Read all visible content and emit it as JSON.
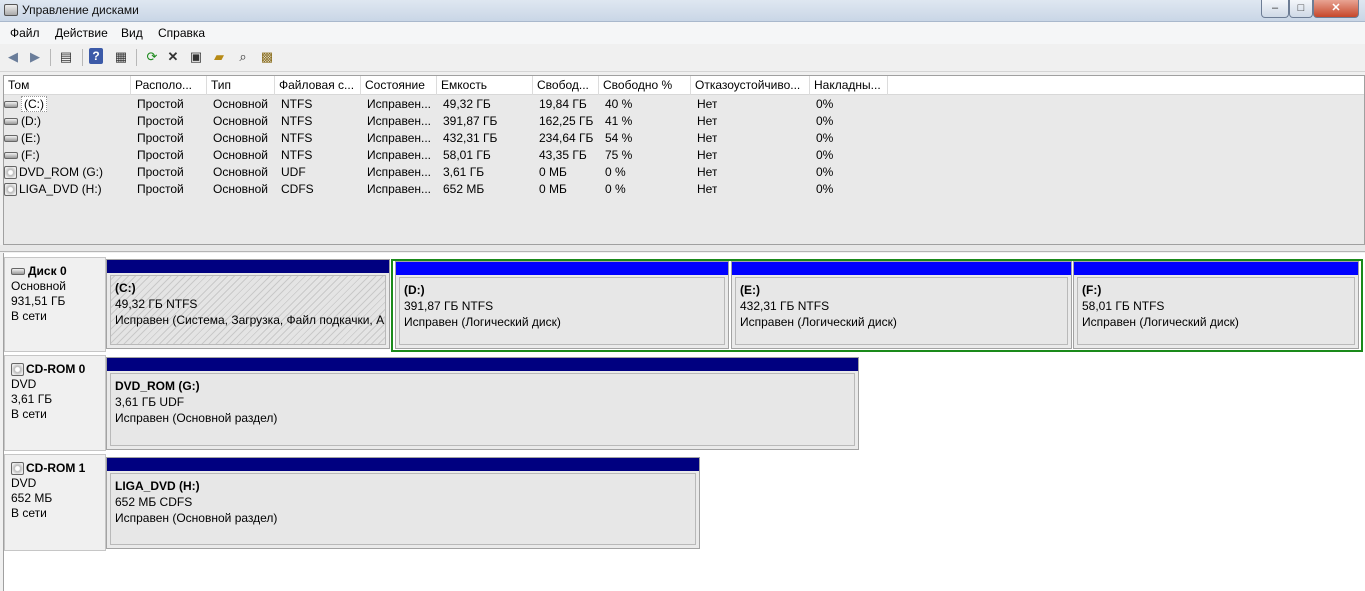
{
  "window": {
    "title": "Управление дисками",
    "min_label": "–",
    "max_label": "□",
    "close_label": "✕"
  },
  "menu": [
    "Файл",
    "Действие",
    "Вид",
    "Справка"
  ],
  "toolbar_icons": [
    "back-arrow-icon",
    "forward-arrow-icon",
    "console-tree-icon",
    "help-icon",
    "properties-icon",
    "refresh-icon",
    "delete-icon",
    "properties-icon",
    "open-icon",
    "rescan-icon",
    "wizard-icon"
  ],
  "volumes": {
    "columns": [
      "Том",
      "Располо...",
      "Тип",
      "Файловая с...",
      "Состояние",
      "Емкость",
      "Свобод...",
      "Свободно %",
      "Отказоустойчиво...",
      "Накладны..."
    ],
    "rows": [
      {
        "name": "(C:)",
        "icon": "drive",
        "layout": "Простой",
        "type": "Основной",
        "fs": "NTFS",
        "status": "Исправен...",
        "capacity": "49,32 ГБ",
        "free": "19,84 ГБ",
        "free_pct": "40 %",
        "fault": "Нет",
        "overhead": "0%"
      },
      {
        "name": "(D:)",
        "icon": "drive",
        "layout": "Простой",
        "type": "Основной",
        "fs": "NTFS",
        "status": "Исправен...",
        "capacity": "391,87 ГБ",
        "free": "162,25 ГБ",
        "free_pct": "41 %",
        "fault": "Нет",
        "overhead": "0%"
      },
      {
        "name": "(E:)",
        "icon": "drive",
        "layout": "Простой",
        "type": "Основной",
        "fs": "NTFS",
        "status": "Исправен...",
        "capacity": "432,31 ГБ",
        "free": "234,64 ГБ",
        "free_pct": "54 %",
        "fault": "Нет",
        "overhead": "0%"
      },
      {
        "name": "(F:)",
        "icon": "drive",
        "layout": "Простой",
        "type": "Основной",
        "fs": "NTFS",
        "status": "Исправен...",
        "capacity": "58,01 ГБ",
        "free": "43,35 ГБ",
        "free_pct": "75 %",
        "fault": "Нет",
        "overhead": "0%"
      },
      {
        "name": "DVD_ROM (G:)",
        "icon": "cd",
        "layout": "Простой",
        "type": "Основной",
        "fs": "UDF",
        "status": "Исправен...",
        "capacity": "3,61 ГБ",
        "free": "0 МБ",
        "free_pct": "0 %",
        "fault": "Нет",
        "overhead": "0%"
      },
      {
        "name": "LIGA_DVD (H:)",
        "icon": "cd",
        "layout": "Простой",
        "type": "Основной",
        "fs": "CDFS",
        "status": "Исправен...",
        "capacity": "652 МБ",
        "free": "0 МБ",
        "free_pct": "0 %",
        "fault": "Нет",
        "overhead": "0%"
      }
    ]
  },
  "disks": [
    {
      "name": "Диск 0",
      "type": "Основной",
      "size": "931,51 ГБ",
      "status": "В сети",
      "partitions": [
        {
          "name": "(C:)",
          "info": "49,32 ГБ NTFS",
          "status": "Исправен (Система, Загрузка, Файл подкачки, Ак",
          "bar_color": "#000080",
          "hatched": true
        },
        {
          "name": "(D:)",
          "info": "391,87 ГБ NTFS",
          "status": "Исправен (Логический диск)",
          "bar_color": "#0000ff",
          "hatched": false
        },
        {
          "name": "(E:)",
          "info": "432,31 ГБ NTFS",
          "status": "Исправен (Логический диск)",
          "bar_color": "#0000ff",
          "hatched": false
        },
        {
          "name": "(F:)",
          "info": "58,01 ГБ NTFS",
          "status": "Исправен (Логический диск)",
          "bar_color": "#0000ff",
          "hatched": false
        }
      ]
    },
    {
      "name": "CD-ROM 0",
      "type": "DVD",
      "size": "3,61 ГБ",
      "status": "В сети",
      "partitions": [
        {
          "name": "DVD_ROM  (G:)",
          "info": "3,61 ГБ UDF",
          "status": "Исправен (Основной раздел)",
          "bar_color": "#000080",
          "hatched": false
        }
      ]
    },
    {
      "name": "CD-ROM 1",
      "type": "DVD",
      "size": "652 МБ",
      "status": "В сети",
      "partitions": [
        {
          "name": "LIGA_DVD  (H:)",
          "info": "652 МБ CDFS",
          "status": "Исправен (Основной раздел)",
          "bar_color": "#000080",
          "hatched": false
        }
      ]
    }
  ],
  "colors": {
    "primary_bar": "#000080",
    "logical_bar": "#0000ff",
    "extended_border": "#1a8a1a"
  }
}
